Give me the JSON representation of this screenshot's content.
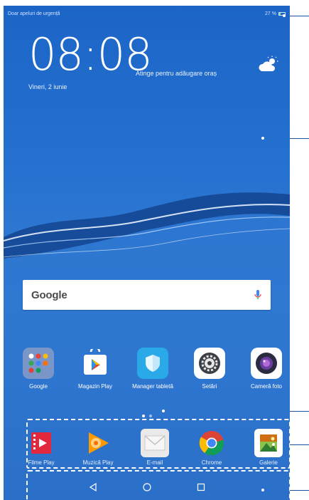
{
  "statusbar": {
    "left_text": "Doar apeluri de urgență",
    "battery_text": "27 %"
  },
  "clock": {
    "time": "08:08",
    "city_prompt": "Atinge pentru adăugare oraș",
    "date": "Vineri, 2 iunie",
    "weather_icon": "partly-cloudy-icon"
  },
  "search": {
    "logo": "Google",
    "mic_icon": "microphone-icon"
  },
  "apps": [
    {
      "label": "Google",
      "icon": "google-folder-icon",
      "color": "#7a96c9"
    },
    {
      "label": "Magazin Play",
      "icon": "play-store-icon",
      "color": "#ffffff"
    },
    {
      "label": "Manager tabletă",
      "icon": "shield-icon",
      "color": "#2aa9e8"
    },
    {
      "label": "Setări",
      "icon": "gear-icon",
      "color": "#ffffff"
    },
    {
      "label": "Cameră foto",
      "icon": "camera-icon",
      "color": "#ffffff"
    }
  ],
  "dock": [
    {
      "label": "Filme Play",
      "icon": "film-icon",
      "color": "#e2283d"
    },
    {
      "label": "Muzică Play",
      "icon": "music-icon",
      "color": "#ff9900"
    },
    {
      "label": "E-mail",
      "icon": "mail-icon",
      "color": "#e9e9e9"
    },
    {
      "label": "Chrome",
      "icon": "chrome-icon",
      "color": "#db4437"
    },
    {
      "label": "Galerie",
      "icon": "gallery-icon",
      "color": "#ffffff"
    }
  ],
  "navbar": {
    "back_icon": "back-triangle-icon",
    "home_icon": "home-circle-icon",
    "recents_icon": "recents-square-icon"
  },
  "colors": {
    "wallpaper": "#2470cf",
    "callout_line": "#1a4f9d"
  }
}
